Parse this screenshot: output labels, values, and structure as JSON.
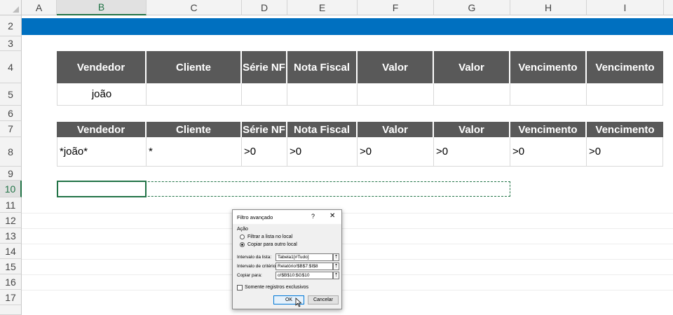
{
  "columns": [
    "A",
    "B",
    "C",
    "D",
    "E",
    "F",
    "G",
    "H",
    "I"
  ],
  "rows": [
    "2",
    "3",
    "4",
    "5",
    "6",
    "7",
    "8",
    "9",
    "10",
    "11",
    "12",
    "13",
    "14",
    "15",
    "16",
    "17"
  ],
  "table1": {
    "headers": [
      "Vendedor",
      "Cliente",
      "Série NF",
      "Nota Fiscal",
      "Valor",
      "Valor",
      "Vencimento",
      "Vencimento"
    ],
    "row": [
      "joão",
      "",
      "",
      "",
      "",
      "",
      "",
      ""
    ]
  },
  "table2": {
    "headers": [
      "Vendedor",
      "Cliente",
      "Série NF",
      "Nota Fiscal",
      "Valor",
      "Valor",
      "Vencimento",
      "Vencimento"
    ],
    "row": [
      "*joão*",
      "*",
      ">0",
      ">0",
      ">0",
      ">0",
      ">0",
      ">0"
    ]
  },
  "dialog": {
    "title": "Filtro avançado",
    "help": "?",
    "close": "✕",
    "group_label": "Ação",
    "option_filter": "Filtrar a lista no local",
    "option_copy": "Copiar para outro local",
    "list_range_label": "Intervalo da lista:",
    "list_range_value": "Tabela1[#Tudo]",
    "criteria_range_label": "Intervalo de critérios:",
    "criteria_range_value": "Relatório!$B$7:$I$8",
    "copy_to_label": "Copiar para:",
    "copy_to_value": "o!$B$10:$G$10",
    "unique_label": "Somente registros exclusivos",
    "ok_label": "OK",
    "cancel_label": "Cancelar"
  },
  "colors": {
    "blue_bar": "#0070c0",
    "header_fill": "#595959",
    "selection": "#217346"
  }
}
